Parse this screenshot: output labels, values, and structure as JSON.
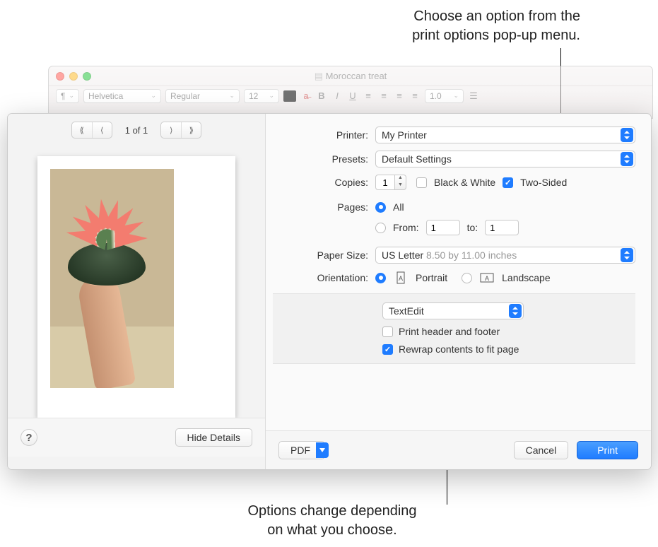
{
  "callouts": {
    "top": "Choose an option from the\nprint options pop-up menu.",
    "bottom": "Options change depending\non what you choose."
  },
  "window": {
    "title": "Moroccan treat",
    "toolbar": {
      "para": "¶",
      "font": "Helvetica",
      "weight": "Regular",
      "size": "12",
      "linespc": "1.0"
    }
  },
  "sheet": {
    "nav": {
      "page": "1 of 1"
    },
    "labels": {
      "printer": "Printer:",
      "presets": "Presets:",
      "copies": "Copies:",
      "bw": "Black & White",
      "twosided": "Two-Sided",
      "pages": "Pages:",
      "all": "All",
      "from": "From:",
      "to": "to:",
      "papersize": "Paper Size:",
      "orientation": "Orientation:",
      "portrait": "Portrait",
      "landscape": "Landscape"
    },
    "values": {
      "printer": "My Printer",
      "presets": "Default Settings",
      "copies": "1",
      "from": "1",
      "to": "1",
      "papersize": "US Letter",
      "papersize_dim": "8.50 by 11.00 inches",
      "appmenu": "TextEdit"
    },
    "appopts": {
      "header": "Print header and footer",
      "rewrap": "Rewrap contents to fit page"
    },
    "buttons": {
      "help": "?",
      "hide": "Hide Details",
      "pdf": "PDF",
      "cancel": "Cancel",
      "print": "Print"
    }
  }
}
